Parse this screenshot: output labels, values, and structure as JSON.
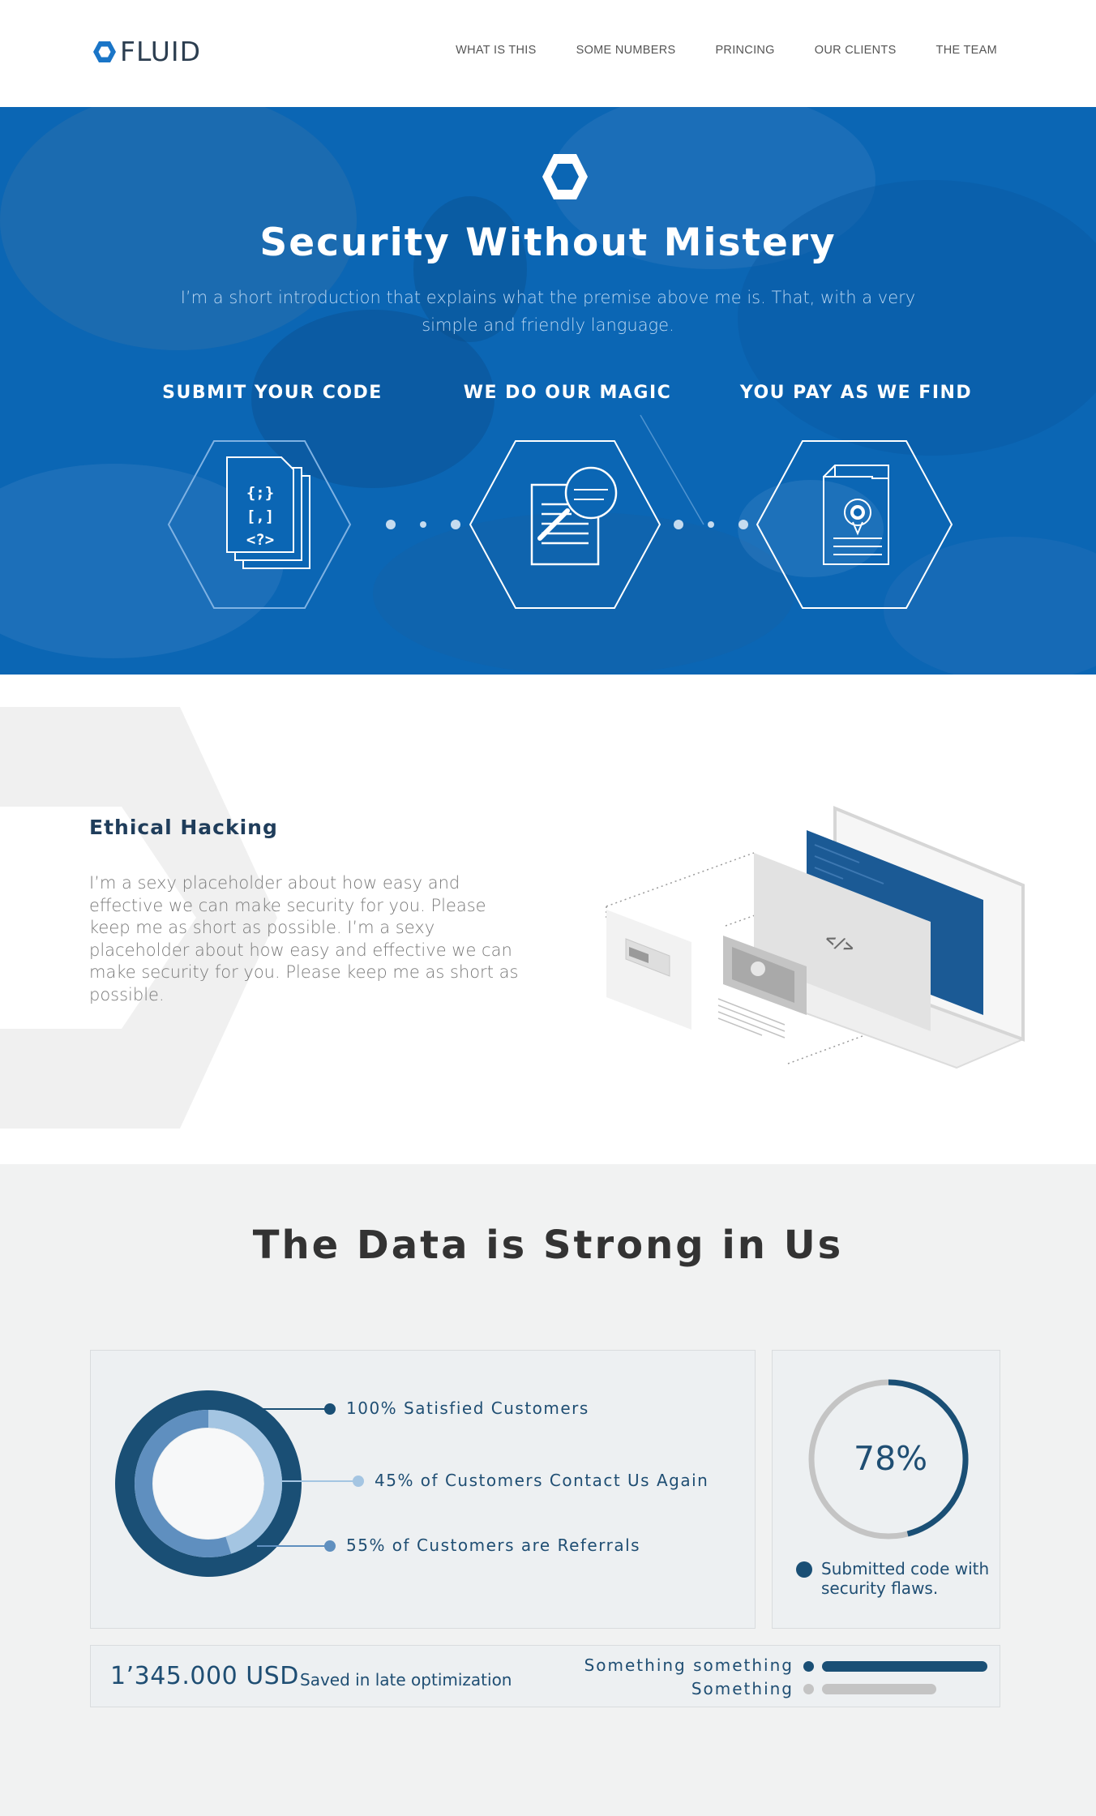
{
  "header": {
    "logo_text": "FLUID",
    "nav": [
      "WHAT IS THIS",
      "SOME NUMBERS",
      "PRINCING",
      "OUR CLIENTS",
      "THE TEAM"
    ]
  },
  "hero": {
    "title": "Security Without Mistery",
    "intro": "I’m a short introduction that explains what the premise above me is. That, with a very simple and friendly language.",
    "steps": [
      {
        "title": "SUBMIT YOUR CODE",
        "icon": "code-files-icon",
        "glyph_lines": [
          "{;}",
          "[,]",
          "<?>"
        ]
      },
      {
        "title": "WE DO OUR MAGIC",
        "icon": "magnifier-document-icon"
      },
      {
        "title": "YOU PAY AS WE FIND",
        "icon": "bug-document-icon"
      }
    ],
    "colors": {
      "overlay": "#0a66b4"
    }
  },
  "ethical": {
    "title": "Ethical Hacking",
    "text": "I’m a sexy placeholder about how easy and effective we can make security for you. Please keep me as short as possible. I’m a sexy placeholder about how easy and effective we can make security for you. Please keep me as short as possible.",
    "illustration_code": "</>"
  },
  "data_section": {
    "title": "The Data is Strong in Us",
    "donut": {
      "items": [
        {
          "label": "100% Satisfied Customers",
          "value": 100,
          "color": "#1a4f75"
        },
        {
          "label": "45% of Customers Contact Us Again",
          "value": 45,
          "color": "#a4c5e2"
        },
        {
          "label": "55% of Customers are Referrals",
          "value": 55,
          "color": "#5f8fbf"
        }
      ]
    },
    "progress": {
      "value_text": "78%",
      "value": 0.78,
      "caption": "Submitted code with security flaws.",
      "color": "#1a4f75",
      "track_color": "#c4c4c4"
    },
    "savings": {
      "value": "1’345.000 USD",
      "caption": "Saved in late optimization"
    },
    "bars": [
      {
        "label": "Something something",
        "fraction": 1.0,
        "color": "#1a4f75"
      },
      {
        "label": "Something",
        "fraction": 0.69,
        "color": "#c4c4c4"
      }
    ]
  }
}
